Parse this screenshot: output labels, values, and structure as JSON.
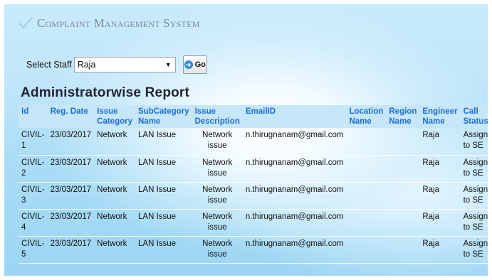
{
  "app": {
    "title": "Complaint Management System"
  },
  "filter": {
    "label": "Select Staff",
    "selected": "Raja",
    "go_label": "Go"
  },
  "report": {
    "heading": "Administratorwise Report",
    "columns": [
      "Id",
      "Reg. Date",
      "Issue Category",
      "SubCategory Name",
      "Issue Description",
      "EmailID",
      "Location Name",
      "Region Name",
      "Engineer Name",
      "Call Status"
    ],
    "rows": [
      {
        "id": "CIVIL-1",
        "reg_date": "23/03/2017",
        "issue_category": "Network",
        "subcategory": "LAN Issue",
        "description": "Network issue",
        "email": "n.thirugnanam@gmail.com",
        "location": "",
        "region": "",
        "engineer": "Raja",
        "status": "Assign to SE"
      },
      {
        "id": "CIVIL-2",
        "reg_date": "23/03/2017",
        "issue_category": "Network",
        "subcategory": "LAN Issue",
        "description": "Network issue",
        "email": "n.thirugnanam@gmail.com",
        "location": "",
        "region": "",
        "engineer": "Raja",
        "status": "Assign to SE"
      },
      {
        "id": "CIVIL-3",
        "reg_date": "23/03/2017",
        "issue_category": "Network",
        "subcategory": "LAN Issue",
        "description": "Network issue",
        "email": "n.thirugnanam@gmail.com",
        "location": "",
        "region": "",
        "engineer": "Raja",
        "status": "Assign to SE"
      },
      {
        "id": "CIVIL-4",
        "reg_date": "23/03/2017",
        "issue_category": "Network",
        "subcategory": "LAN Issue",
        "description": "Network issue",
        "email": "n.thirugnanam@gmail.com",
        "location": "",
        "region": "",
        "engineer": "Raja",
        "status": "Assign to SE"
      },
      {
        "id": "CIVIL-5",
        "reg_date": "23/03/2017",
        "issue_category": "Network",
        "subcategory": "LAN Issue",
        "description": "Network issue",
        "email": "n.thirugnanam@gmail.com",
        "location": "",
        "region": "",
        "engineer": "Raja",
        "status": "Assign to SE"
      }
    ]
  },
  "colors": {
    "header_bg": "#c6e6f9",
    "header_text": "#1f6fcf",
    "logo_check": "#9fcbe6"
  },
  "icons": {
    "logo": "checkmark-icon",
    "go": "arrow-right-circle-icon",
    "dropdown": "dropdown-arrow-icon"
  }
}
